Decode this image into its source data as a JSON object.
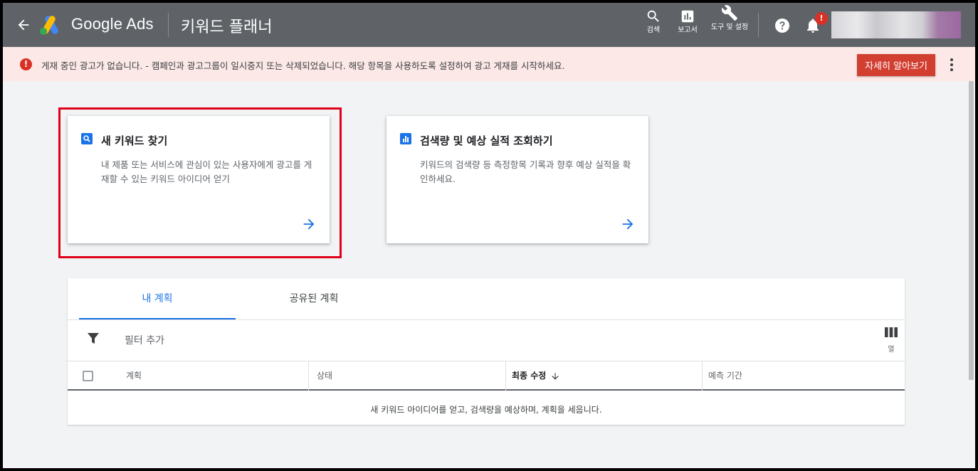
{
  "header": {
    "brand": "Google Ads",
    "page_title": "키워드 플래너",
    "tools": [
      {
        "label": "검색",
        "icon": "search-icon"
      },
      {
        "label": "보고서",
        "icon": "reports-icon"
      },
      {
        "label": "도구 및 설정",
        "icon": "wrench-icon"
      }
    ],
    "notification_badge": "!"
  },
  "alert": {
    "icon_text": "!",
    "message": "게재 중인 광고가 없습니다. - 캠페인과 광고그룹이 일시중지 또는 삭제되었습니다. 해당 항목을 사용하도록 설정하여 광고 게재를 시작하세요.",
    "button_label": "자세히 알아보기"
  },
  "cards": [
    {
      "title": "새 키워드 찾기",
      "description": "내 제품 또는 서비스에 관심이 있는 사용자에게 광고를 게재할 수 있는 키워드 아이디어 얻기",
      "highlighted": true
    },
    {
      "title": "검색량 및 예상 실적 조회하기",
      "description": "키워드의 검색량 등 측정항목 기록과 향후 예상 실적을 확인하세요.",
      "highlighted": false
    }
  ],
  "plans": {
    "tabs": [
      {
        "label": "내 계획",
        "active": true
      },
      {
        "label": "공유된 계획",
        "active": false
      }
    ],
    "filter_label": "필터 추가",
    "columns_label": "열",
    "table": {
      "headers": [
        "계획",
        "상태",
        "최종 수정",
        "예측 기간"
      ],
      "sorted_column": "최종 수정",
      "sort_direction": "desc",
      "empty_message": "새 키워드 아이디어를 얻고, 검색량을 예상하며, 계획을 세웁니다."
    }
  },
  "colors": {
    "header_bg": "#5f6368",
    "alert_bg": "#fce8e6",
    "accent_blue": "#1a73e8",
    "alert_red": "#d93025",
    "highlight_red": "#e0001a"
  }
}
